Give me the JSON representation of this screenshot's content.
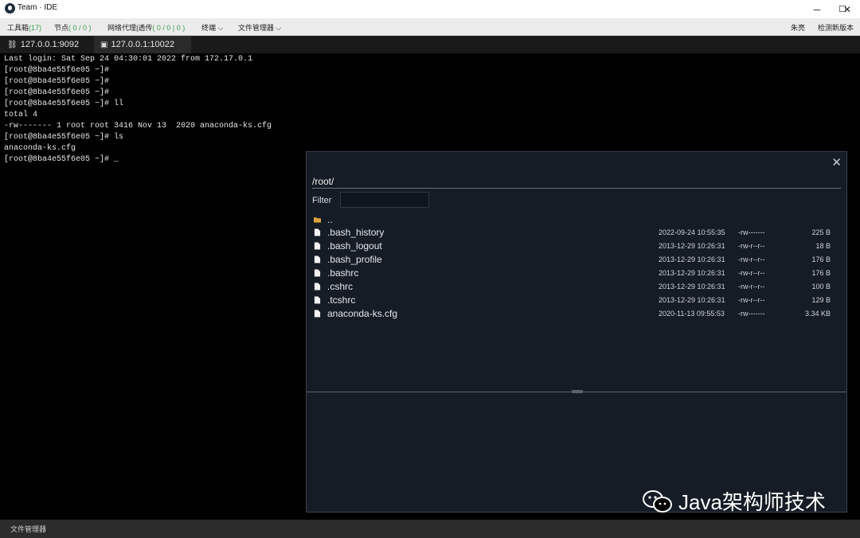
{
  "window": {
    "title": "Team · IDE",
    "controls": [
      "─",
      "☐",
      "✕"
    ]
  },
  "menubar": {
    "toolbox_label": "工具箱",
    "toolbox_count": "(17)",
    "nodes_label": "节点",
    "nodes_count": "( 0 / 0 )",
    "proxy_label": "网络代理|透传",
    "proxy_count": "( 0 / 0 | 0 )",
    "terminal_label": "终端",
    "filemanager_label": "文件管理器",
    "user_name": "朱亮",
    "check_update": "检测新版本"
  },
  "tabs": [
    {
      "label": "127.0.0.1:9092",
      "icon": "node-icon",
      "active": false
    },
    {
      "label": "127.0.0.1:10022",
      "icon": "terminal-icon",
      "active": true
    }
  ],
  "terminal": {
    "lines": [
      "Last login: Sat Sep 24 04:30:01 2022 from 172.17.0.1",
      "[root@8ba4e55f6e05 ~]#",
      "[root@8ba4e55f6e05 ~]#",
      "[root@8ba4e55f6e05 ~]#",
      "[root@8ba4e55f6e05 ~]# ll",
      "total 4",
      "-rw------- 1 root root 3416 Nov 13  2020 anaconda-ks.cfg",
      "[root@8ba4e55f6e05 ~]# ls",
      "anaconda-ks.cfg",
      "[root@8ba4e55f6e05 ~]# _"
    ]
  },
  "file_manager": {
    "path": "/root/",
    "filter_label": "Filter",
    "filter_value": "",
    "close_icon": "✕",
    "files": [
      {
        "name": "..",
        "type": "folder",
        "date": "",
        "perm": "",
        "size": ""
      },
      {
        "name": ".bash_history",
        "type": "file",
        "date": "2022-09-24 10:55:35",
        "perm": "-rw-------",
        "size": "225 B"
      },
      {
        "name": ".bash_logout",
        "type": "file",
        "date": "2013-12-29 10:26:31",
        "perm": "-rw-r--r--",
        "size": "18 B"
      },
      {
        "name": ".bash_profile",
        "type": "file",
        "date": "2013-12-29 10:26:31",
        "perm": "-rw-r--r--",
        "size": "176 B"
      },
      {
        "name": ".bashrc",
        "type": "file",
        "date": "2013-12-29 10:26:31",
        "perm": "-rw-r--r--",
        "size": "176 B"
      },
      {
        "name": ".cshrc",
        "type": "file",
        "date": "2013-12-29 10:26:31",
        "perm": "-rw-r--r--",
        "size": "100 B"
      },
      {
        "name": ".tcshrc",
        "type": "file",
        "date": "2013-12-29 10:26:31",
        "perm": "-rw-r--r--",
        "size": "129 B"
      },
      {
        "name": "anaconda-ks.cfg",
        "type": "file",
        "date": "2020-11-13 09:55:53",
        "perm": "-rw-------",
        "size": "3.34 KB"
      }
    ]
  },
  "watermark": {
    "text": "Java架构师技术"
  },
  "statusbar": {
    "label": "文件管理器"
  },
  "colors": {
    "accent_green": "#3c9b4b",
    "folder": "#e0a43a",
    "panel_bg": "#151c25"
  }
}
